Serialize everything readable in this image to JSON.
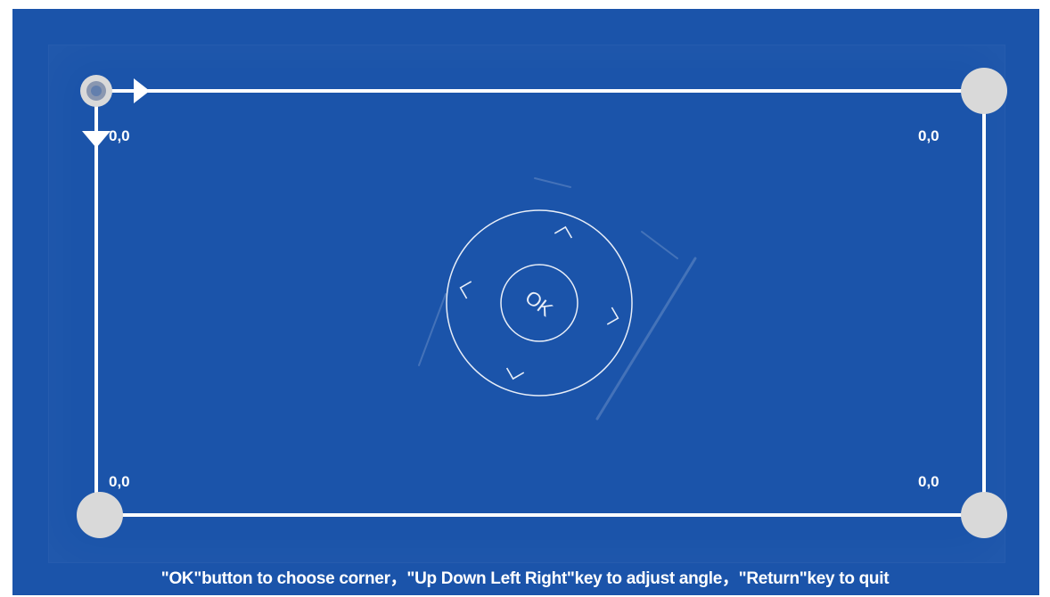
{
  "screen": {
    "background_color": "#1b54aa",
    "line_color": "#ffffff",
    "corner_handle_color": "#d9d9d9",
    "active_handle_ring_color": "#8a97b0"
  },
  "corners": {
    "top_left": {
      "label": "0,0",
      "active": true
    },
    "top_right": {
      "label": "0,0",
      "active": false
    },
    "bottom_left": {
      "label": "0,0",
      "active": false
    },
    "bottom_right": {
      "label": "0,0",
      "active": false
    }
  },
  "dial": {
    "ok_label": "OK",
    "icons": [
      "dial-outer-ring",
      "ok-inner-ring",
      "corner-bracket-icons"
    ]
  },
  "arrows": [
    "arrow-right-icon",
    "arrow-down-icon"
  ],
  "instruction_text": "\"OK\"button to choose corner，\"Up Down Left Right\"key to adjust angle，\"Return\"key to quit"
}
